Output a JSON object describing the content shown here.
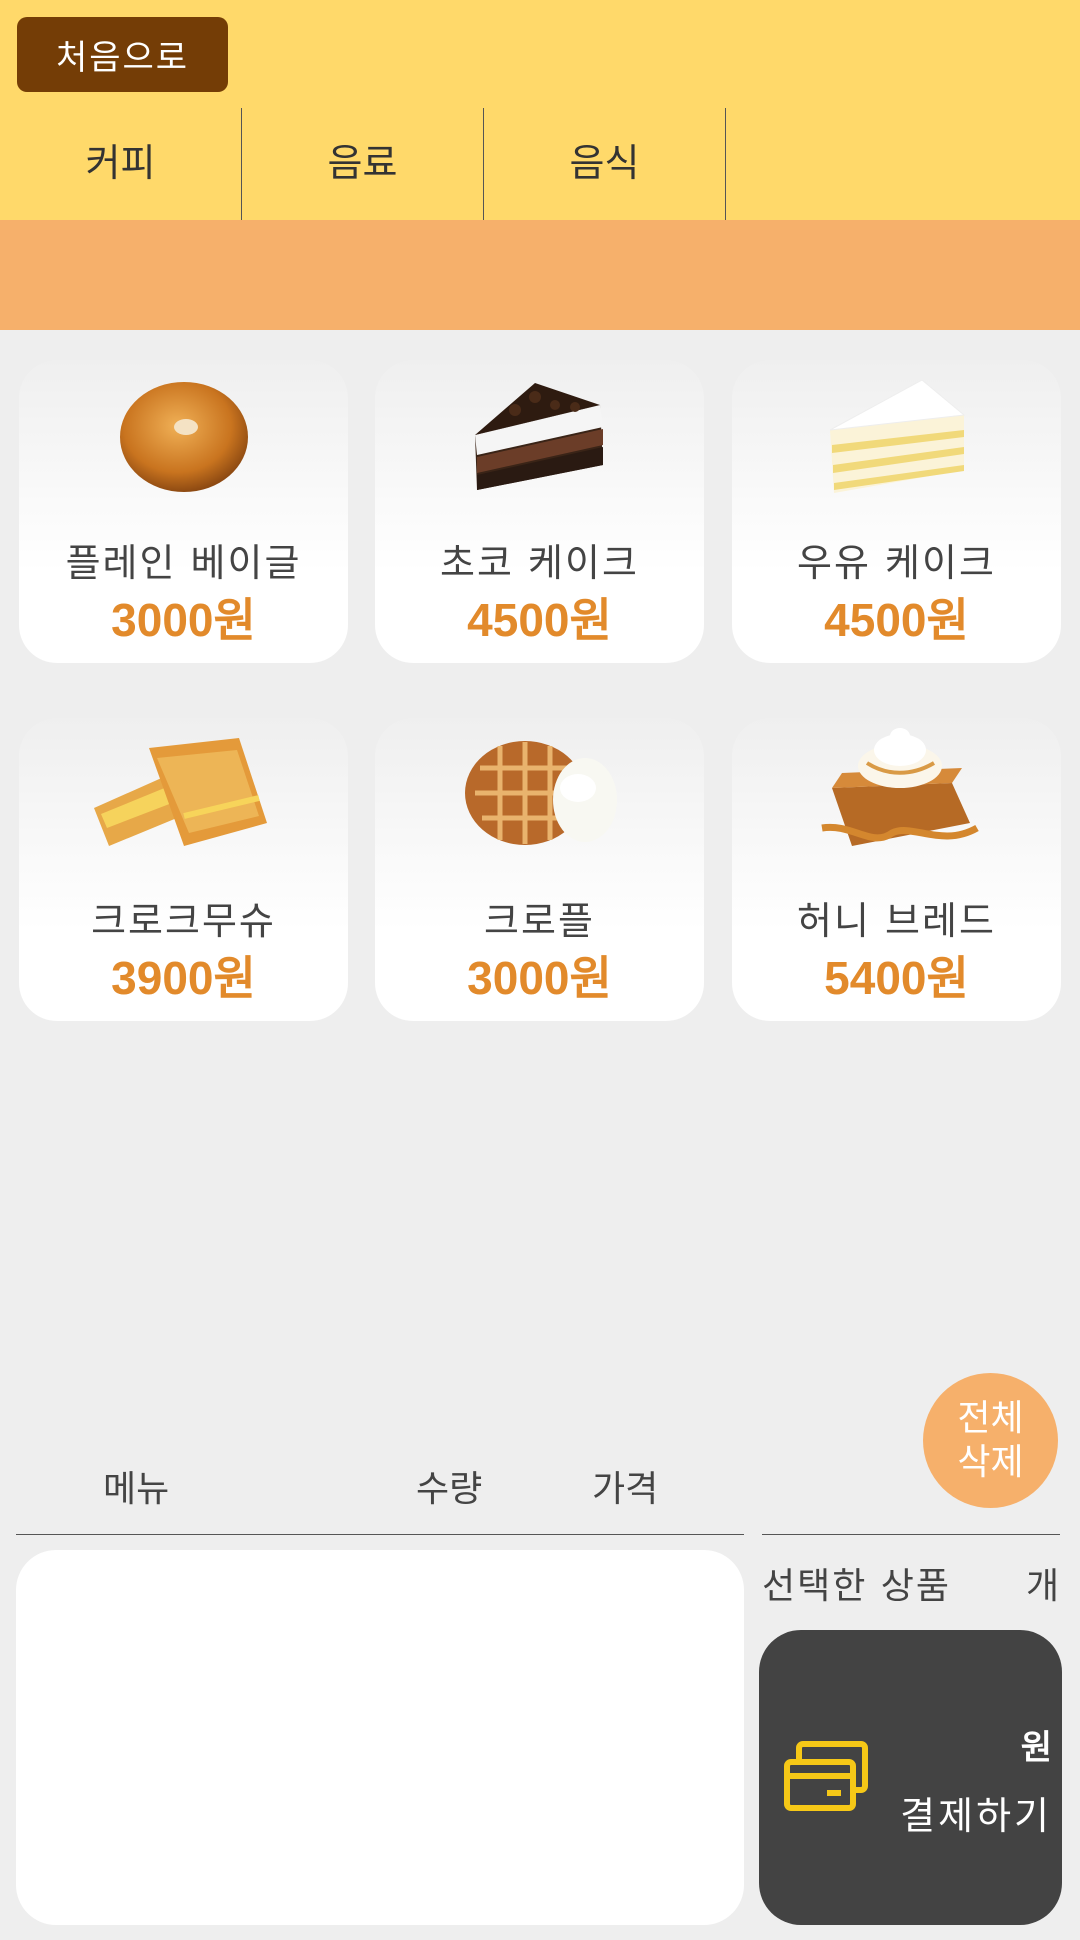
{
  "header": {
    "home_label": "처음으로",
    "tabs": [
      {
        "label": "커피"
      },
      {
        "label": "음료"
      },
      {
        "label": "음식"
      }
    ]
  },
  "products": [
    {
      "name": "플레인 베이글",
      "price": "3000원",
      "icon": "bagel-image"
    },
    {
      "name": "초코 케이크",
      "price": "4500원",
      "icon": "chocolate-cake-image"
    },
    {
      "name": "우유 케이크",
      "price": "4500원",
      "icon": "milk-cake-image"
    },
    {
      "name": "크로크무슈",
      "price": "3900원",
      "icon": "croque-monsieur-image"
    },
    {
      "name": "크로플",
      "price": "3000원",
      "icon": "croffle-image"
    },
    {
      "name": "허니 브레드",
      "price": "5400원",
      "icon": "honey-bread-image"
    }
  ],
  "order": {
    "clear_all": [
      "전체",
      "삭제"
    ],
    "columns": {
      "menu": "메뉴",
      "qty": "수량",
      "price": "가격"
    },
    "selected_label": "선택한 상품",
    "selected_unit": "개",
    "total_unit": "원",
    "pay_label": "결제하기",
    "pay_icon": "card-icon"
  },
  "colors": {
    "header_bg": "#ffd96a",
    "home_button": "#743d06",
    "banner": "#f6b06b",
    "price_text": "#e28a2b",
    "pay_button": "#434343",
    "pay_icon": "#f6c817"
  }
}
